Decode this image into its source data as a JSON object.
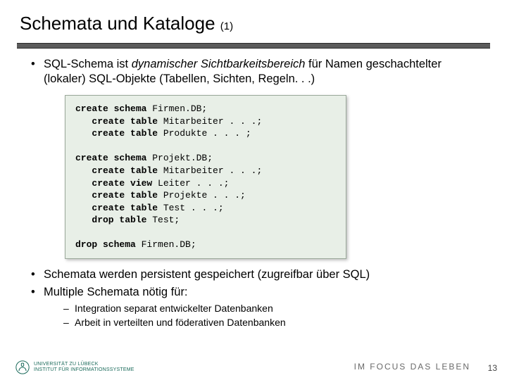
{
  "title": {
    "main": "Schemata und Kataloge",
    "sub": "(1)"
  },
  "points": {
    "p1a": "SQL-Schema ist ",
    "p1b": "dynamischer Sichtbarkeitsbereich",
    "p1c": " für Namen geschachtelter (lokaler) SQL-Objekte (Tabellen, Sichten, Regeln. . .)",
    "p2": "Schemata werden persistent gespeichert (zugreifbar über SQL)",
    "p3": "Multiple Schemata nötig für:",
    "sub1": "Integration separat entwickelter Datenbanken",
    "sub2": "Arbeit in verteilten und föderativen Datenbanken"
  },
  "code": {
    "l1a": "create schema",
    "l1b": " Firmen.DB;",
    "l2a": "   create table",
    "l2b": " Mitarbeiter . . .;",
    "l3a": "   create table",
    "l3b": " Produkte . . . ;",
    "l4": "",
    "l5a": "create schema",
    "l5b": " Projekt.DB;",
    "l6a": "   create table",
    "l6b": " Mitarbeiter . . .;",
    "l7a": "   create view",
    "l7b": " Leiter . . .;",
    "l8a": "   create table",
    "l8b": " Projekte . . .;",
    "l9a": "   create table",
    "l9b": " Test . . .;",
    "l10a": "   drop table",
    "l10b": " Test;",
    "l11": "",
    "l12a": "drop schema",
    "l12b": " Firmen.DB;"
  },
  "footer": {
    "logo_line1": "UNIVERSITÄT ZU LÜBECK",
    "logo_line2": "INSTITUT FÜR INFORMATIONSSYSTEME",
    "tagline": "IM FOCUS DAS LEBEN",
    "page": "13"
  }
}
